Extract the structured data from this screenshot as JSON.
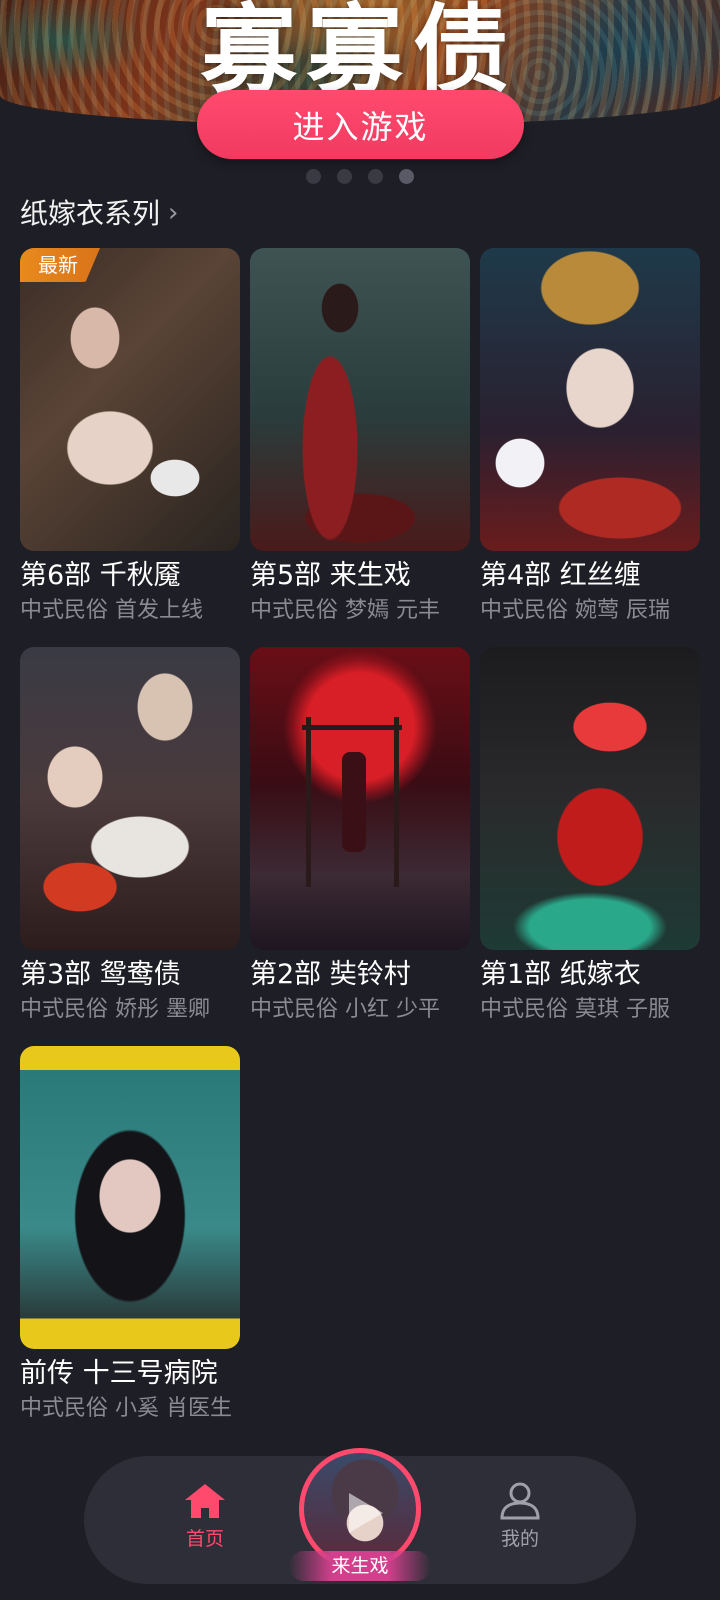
{
  "banner": {
    "title": "寡寡债",
    "enter_button": "进入游戏",
    "dots": 4,
    "active_dot": 3
  },
  "section": {
    "title": "纸嫁衣系列",
    "chevron": "›"
  },
  "cards": [
    {
      "title": "第6部 千秋魇",
      "subtitle": "中式民俗 首发上线",
      "badge": "最新"
    },
    {
      "title": "第5部 来生戏",
      "subtitle": "中式民俗 梦嫣 元丰"
    },
    {
      "title": "第4部 红丝缠",
      "subtitle": "中式民俗 婉莺 辰瑞"
    },
    {
      "title": "第3部 鸳鸯债",
      "subtitle": "中式民俗 娇彤 墨卿"
    },
    {
      "title": "第2部 奘铃村",
      "subtitle": "中式民俗 小红 少平"
    },
    {
      "title": "第1部 纸嫁衣",
      "subtitle": "中式民俗 莫琪 子服"
    },
    {
      "title": "前传 十三号病院",
      "subtitle": "中式民俗 小奚 肖医生"
    }
  ],
  "bottom_nav": {
    "home_label": "首页",
    "center_label": "来生戏",
    "mine_label": "我的"
  },
  "colors": {
    "accent": "#ff4a6e",
    "background": "#1e1e26",
    "badge": "#e88a1c"
  }
}
